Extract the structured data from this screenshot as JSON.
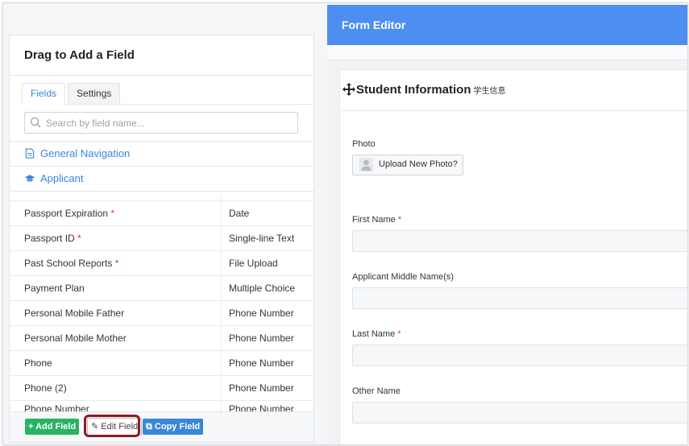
{
  "left_panel": {
    "title": "Drag to Add a Field",
    "tabs": [
      {
        "label": "Fields",
        "active": true
      },
      {
        "label": "Settings",
        "active": false
      }
    ],
    "search": {
      "placeholder": "Search by field name..."
    },
    "nav": [
      {
        "label": "General Navigation",
        "icon": "document-icon"
      },
      {
        "label": "Applicant",
        "icon": "graduation-cap-icon"
      }
    ],
    "fields": [
      {
        "name": "Passport Expiration",
        "required": "*",
        "type": "Date"
      },
      {
        "name": "Passport ID",
        "required": "*",
        "type": "Single-line Text"
      },
      {
        "name": "Past School Reports",
        "required": "*",
        "type": "File Upload"
      },
      {
        "name": "Payment Plan",
        "required": "",
        "type": "Multiple Choice"
      },
      {
        "name": "Personal Mobile Father",
        "required": "",
        "type": "Phone Number"
      },
      {
        "name": "Personal Mobile Mother",
        "required": "",
        "type": "Phone Number"
      },
      {
        "name": "Phone",
        "required": "",
        "type": "Phone Number"
      },
      {
        "name": "Phone (2)",
        "required": "",
        "type": "Phone Number"
      },
      {
        "name": "Phone Number",
        "required": "",
        "type": "Phone Number"
      }
    ],
    "buttons": {
      "add": "+ Add Field",
      "edit": "Edit Field",
      "copy": "Copy Field"
    }
  },
  "editor": {
    "title": "Form Editor",
    "section": {
      "title": "Student Information",
      "subtitle": "学生信息"
    },
    "photo": {
      "label": "Photo",
      "button": "Upload New Photo?"
    },
    "fields": [
      {
        "label": "First Name",
        "required": "*"
      },
      {
        "label": "Applicant Middle Name(s)",
        "required": ""
      },
      {
        "label": "Last Name",
        "required": "*"
      },
      {
        "label": "Other Name",
        "required": ""
      }
    ]
  },
  "colors": {
    "header_blue": "#4c8ff0",
    "link_blue": "#3a86d9",
    "add_green": "#28b463",
    "required_red": "#d9363e",
    "highlight_ring": "#8e1b22"
  }
}
